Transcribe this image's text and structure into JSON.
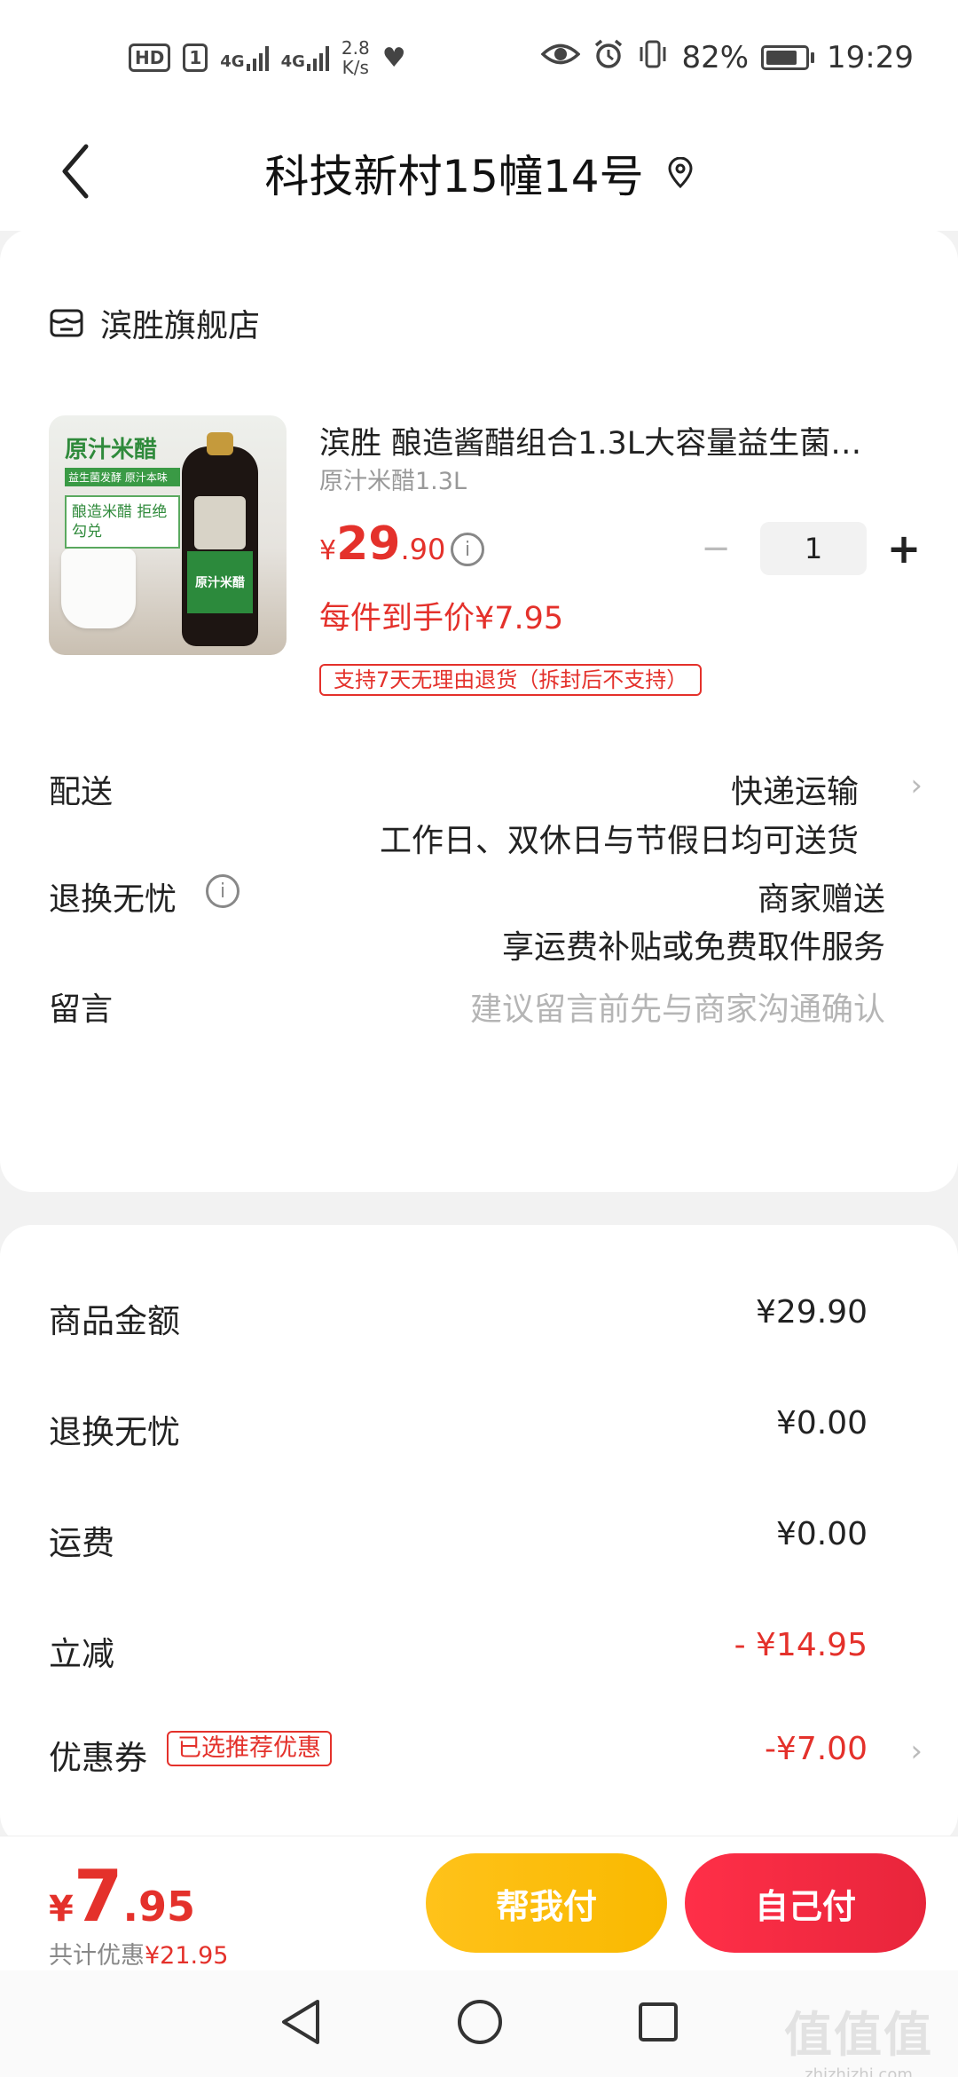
{
  "status_bar": {
    "hd": "HD",
    "sim": "1",
    "net1": "4G",
    "net2": "4G",
    "speed_value": "2.8",
    "speed_unit": "K/s",
    "battery_pct": "82%",
    "battery_level": 0.82,
    "time": "19:29"
  },
  "header": {
    "title": "科技新村15幢14号"
  },
  "store": {
    "name": "滨胜旗舰店"
  },
  "product": {
    "image_banner_title": "原汁米醋",
    "image_banner_sub1": "益生菌发酵",
    "image_banner_sub2": "原汁本味",
    "image_banner_tag": "酿造米醋 拒绝勾兑",
    "image_label": "原汁米醋",
    "title": "滨胜 酿造酱醋组合1.3L大容量益生菌…",
    "spec": "原汁米醋1.3L",
    "price_currency": "¥",
    "price_int": "29",
    "price_dec": ".90",
    "quantity": "1",
    "minus": "−",
    "plus": "+",
    "unit_price": "每件到手价¥7.95",
    "return_policy": "支持7天无理由退货（拆封后不支持）"
  },
  "rows": {
    "delivery_label": "配送",
    "delivery_method": "快递运输",
    "delivery_detail": "工作日、双休日与节假日均可送货",
    "worry_free_label": "退换无忧",
    "worry_free_value": "商家赠送",
    "worry_free_detail": "享运费补贴或免费取件服务",
    "message_label": "留言",
    "message_placeholder": "建议留言前先与商家沟通确认"
  },
  "fees": {
    "goods_label": "商品金额",
    "goods_value": "¥29.90",
    "worry_label": "退换无忧",
    "worry_value": "¥0.00",
    "shipping_label": "运费",
    "shipping_value": "¥0.00",
    "discount_label": "立减",
    "discount_value": "- ¥14.95",
    "coupon_label": "优惠券",
    "coupon_tag": "已选推荐优惠",
    "coupon_value": "-¥7.00"
  },
  "bottom": {
    "total_currency": "¥",
    "total_int": "7",
    "total_dec": ".95",
    "saved_label": "共计优惠",
    "saved_amount": "¥21.95",
    "help_pay": "帮我付",
    "self_pay": "自己付"
  },
  "watermark": {
    "logo": "值值值",
    "site": "zhizhizhi.com"
  },
  "colors": {
    "accent_red": "#e4312b",
    "help_button": "#ffc21a",
    "pay_button": "#ff2f48"
  }
}
